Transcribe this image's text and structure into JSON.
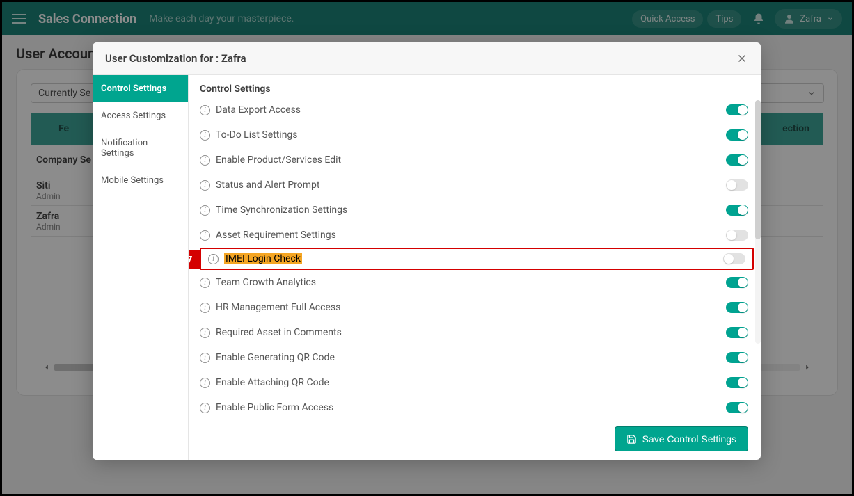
{
  "header": {
    "brand": "Sales Connection",
    "tagline": "Make each day your masterpiece.",
    "quick_access": "Quick Access",
    "tips": "Tips",
    "user_name": "Zafra"
  },
  "page": {
    "title": "User Account",
    "selector_label": "Currently Se",
    "table": {
      "header_left": "Fe",
      "header_right": "ection",
      "company_row": "Company Se",
      "users": [
        {
          "name": "Siti",
          "role": "Admin"
        },
        {
          "name": "Zafra",
          "role": "Admin"
        }
      ]
    }
  },
  "callout": {
    "step_number": "7"
  },
  "modal": {
    "title": "User Customization for :  Zafra",
    "side_nav": [
      {
        "label": "Control Settings",
        "active": true
      },
      {
        "label": "Access Settings",
        "active": false
      },
      {
        "label": "Notification Settings",
        "active": false
      },
      {
        "label": "Mobile Settings",
        "active": false
      }
    ],
    "section_title": "Control Settings",
    "settings": [
      {
        "label": "Data Export Access",
        "on": true,
        "highlight": false
      },
      {
        "label": "To-Do List Settings",
        "on": true,
        "highlight": false
      },
      {
        "label": "Enable Product/Services Edit",
        "on": true,
        "highlight": false
      },
      {
        "label": "Status and Alert Prompt",
        "on": false,
        "highlight": false
      },
      {
        "label": "Time Synchronization Settings",
        "on": true,
        "highlight": false
      },
      {
        "label": "Asset Requirement Settings",
        "on": false,
        "highlight": false
      },
      {
        "label": "IMEI Login Check",
        "on": false,
        "highlight": true
      },
      {
        "label": "Team Growth Analytics",
        "on": true,
        "highlight": false
      },
      {
        "label": "HR Management Full Access",
        "on": true,
        "highlight": false
      },
      {
        "label": "Required Asset in Comments",
        "on": true,
        "highlight": false
      },
      {
        "label": "Enable Generating QR Code",
        "on": true,
        "highlight": false
      },
      {
        "label": "Enable Attaching QR Code",
        "on": true,
        "highlight": false
      },
      {
        "label": "Enable Public Form Access",
        "on": true,
        "highlight": false
      }
    ],
    "save_label": "Save Control Settings"
  }
}
